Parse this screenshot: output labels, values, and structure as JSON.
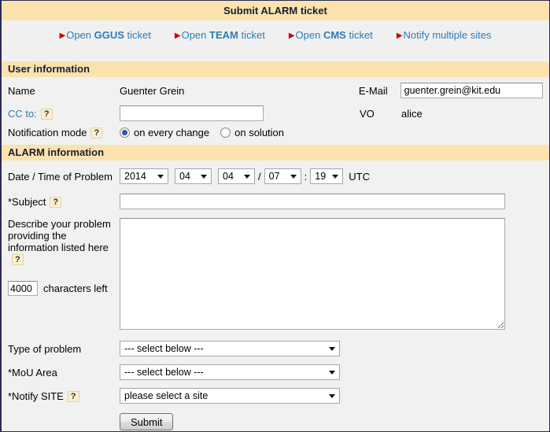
{
  "colors": {
    "header_bg": "#FAE3AC",
    "page_bg": "#F1F1F2",
    "link_blue": "#2F7CB3",
    "arrow_red": "#CC0000"
  },
  "title": "Submit ALARM ticket",
  "nav": {
    "links": [
      {
        "pre": "Open ",
        "strong": "GGUS",
        "post": " ticket"
      },
      {
        "pre": "Open ",
        "strong": "TEAM",
        "post": " ticket"
      },
      {
        "pre": "Open ",
        "strong": "CMS",
        "post": " ticket"
      },
      {
        "pre": "Notify multiple sites",
        "strong": "",
        "post": ""
      }
    ]
  },
  "help_marker": "?",
  "sections": {
    "user": "User information",
    "alarm": "ALARM information"
  },
  "user": {
    "name_label": "Name",
    "name_value": "Guenter Grein",
    "email_label": "E-Mail",
    "email_value": "guenter.grein@kit.edu",
    "cc_label": "CC to:",
    "cc_value": "",
    "vo_label": "VO",
    "vo_value": "alice",
    "notification_label": "Notification mode",
    "radio_on_every_change": "on every change",
    "radio_on_solution": "on solution"
  },
  "alarm": {
    "date_label": "Date / Time of Problem",
    "date": {
      "year": "2014",
      "month": "04",
      "day": "04",
      "hour": "07",
      "minute": "19"
    },
    "date_separator": "/",
    "time_separator": ":",
    "timezone": "UTC",
    "subject_label": "*Subject",
    "subject_value": "",
    "describe_label": "Describe your problem providing the information listed here",
    "describe_value": "",
    "chars_value": "4000",
    "chars_label": "characters left",
    "type_label": "Type of problem",
    "type_value": "--- select below ---",
    "mou_label": "*MoU Area",
    "mou_value": "--- select below ---",
    "site_label": "*Notify SITE",
    "site_value": "please select a site",
    "submit_label": "Submit"
  }
}
